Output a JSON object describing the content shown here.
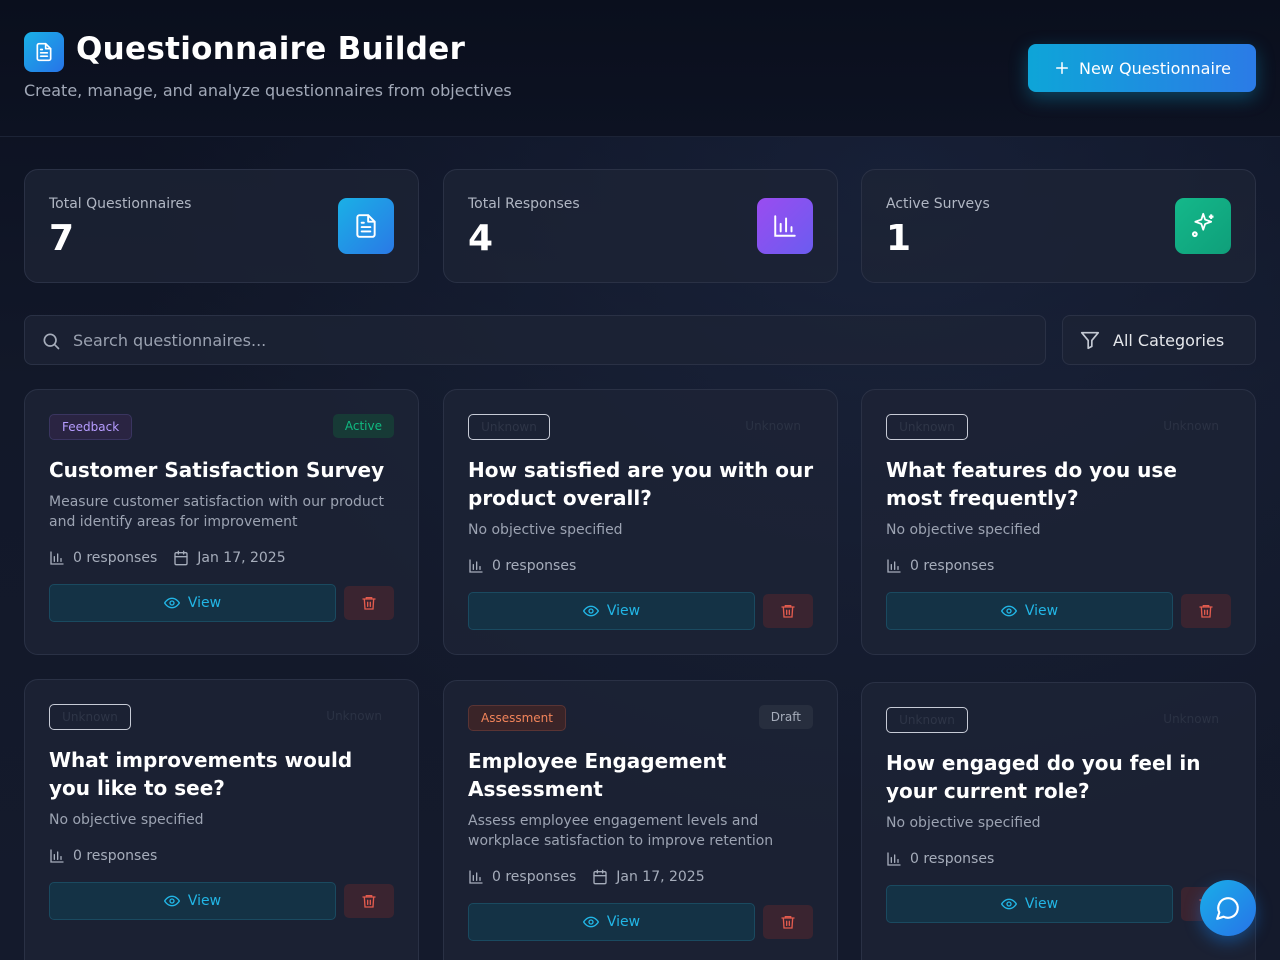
{
  "header": {
    "title": "Questionnaire Builder",
    "subtitle": "Create, manage, and analyze questionnaires from objectives",
    "new_button_label": "New Questionnaire"
  },
  "stats": [
    {
      "label": "Total Questionnaires",
      "value": "7",
      "icon": "document-icon",
      "color": "#1aa6e4"
    },
    {
      "label": "Total Responses",
      "value": "4",
      "icon": "bar-chart-icon",
      "color": "#8b4cf0"
    },
    {
      "label": "Active Surveys",
      "value": "1",
      "icon": "sparkles-icon",
      "color": "#10b981"
    }
  ],
  "search": {
    "placeholder": "Search questionnaires..."
  },
  "filter": {
    "label": "All Categories"
  },
  "cards": [
    {
      "category": "Feedback",
      "status": "Active",
      "title": "Customer Satisfaction Survey",
      "description": "Measure customer satisfaction with our product and identify areas for improvement",
      "responses": "0 responses",
      "date": "Jan 17, 2025",
      "view_label": "View"
    },
    {
      "category": "Unknown",
      "status": "Unknown",
      "title": "How satisfied are you with our product overall?",
      "description": "No objective specified",
      "responses": "0 responses",
      "view_label": "View"
    },
    {
      "category": "Unknown",
      "status": "Unknown",
      "title": "What features do you use most frequently?",
      "description": "No objective specified",
      "responses": "0 responses",
      "view_label": "View"
    },
    {
      "category": "Unknown",
      "status": "Unknown",
      "title": "What improvements would you like to see?",
      "description": "No objective specified",
      "responses": "0 responses",
      "view_label": "View"
    },
    {
      "category": "Assessment",
      "status": "Draft",
      "title": "Employee Engagement Assessment",
      "description": "Assess employee engagement levels and workplace satisfaction to improve retention",
      "responses": "0 responses",
      "date": "Jan 17, 2025",
      "view_label": "View"
    },
    {
      "category": "Unknown",
      "status": "Unknown",
      "title": "How engaged do you feel in your current role?",
      "description": "No objective specified",
      "responses": "0 responses",
      "view_label": "View"
    }
  ],
  "colors": {
    "accent": "#0ea5d8",
    "active_badge": "#10b981",
    "feedback_badge": "#a78bfa",
    "assessment_badge": "#f97316",
    "delete": "#e25b4e"
  }
}
